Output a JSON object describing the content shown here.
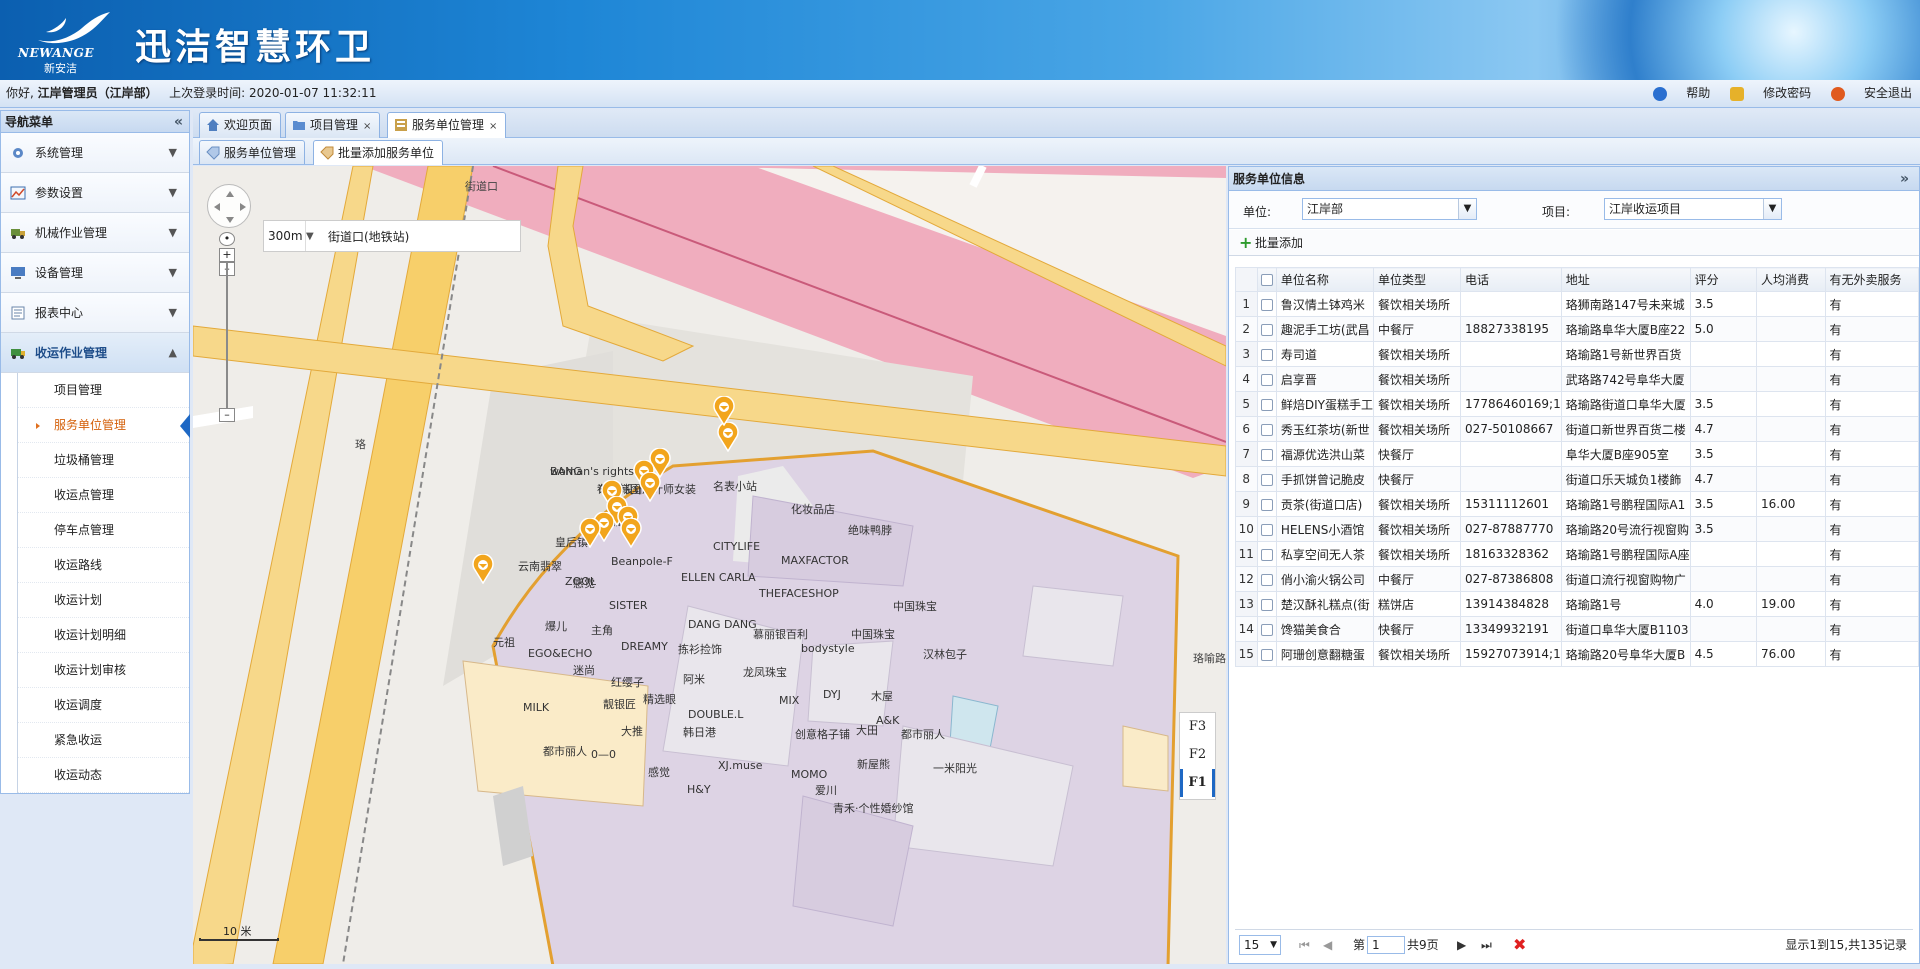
{
  "header": {
    "logo_en": "NEWANGE",
    "logo_cn": "新安洁",
    "title": "迅洁智慧环卫"
  },
  "userbar": {
    "greeting": "你好,",
    "user": "江岸管理员（江岸部）",
    "last_login_label": "上次登录时间:",
    "last_login": "2020-01-07 11:32:11",
    "help": "帮助",
    "change_pwd": "修改密码",
    "logout": "安全退出"
  },
  "nav": {
    "title": "导航菜单",
    "collapse": "«",
    "groups": [
      {
        "label": "系统管理",
        "icon": "gear-icon"
      },
      {
        "label": "参数设置",
        "icon": "chart-icon"
      },
      {
        "label": "机械作业管理",
        "icon": "truck-icon"
      },
      {
        "label": "设备管理",
        "icon": "monitor-icon"
      },
      {
        "label": "报表中心",
        "icon": "report-icon"
      },
      {
        "label": "收运作业管理",
        "icon": "vehicle-icon"
      }
    ],
    "subitems": [
      "项目管理",
      "服务单位管理",
      "垃圾桶管理",
      "收运点管理",
      "停车点管理",
      "收运路线",
      "收运计划",
      "收运计划明细",
      "收运计划审核",
      "收运调度",
      "紧急收运",
      "收运动态"
    ]
  },
  "tabs": {
    "main": [
      {
        "label": "欢迎页面"
      },
      {
        "label": "项目管理",
        "close": "×"
      },
      {
        "label": "服务单位管理",
        "close": "×"
      }
    ],
    "sub": [
      {
        "label": "服务单位管理"
      },
      {
        "label": "批量添加服务单位"
      }
    ]
  },
  "map": {
    "radius": "300m",
    "search": "街道口(地铁站)",
    "station": "街道口",
    "road": "珞喻路",
    "road_side": "珞",
    "floors": [
      "F3",
      "F2",
      "F1"
    ],
    "active_floor": "F1",
    "scale": "10 米",
    "shops": [
      "BANG",
      "布道·设计",
      "名表小站",
      "化妆品店",
      "绝味鸭脖",
      "尚品",
      "皇后镇",
      "CITYLIFE",
      "MAXFACTOR",
      "云南翡翠",
      "感觉",
      "Beanpole-F",
      "ZOOL",
      "ELLEN CARLA",
      "THEFACESHOP",
      "中国珠宝",
      "SISTER",
      "元祖",
      "爆儿",
      "主角",
      "DANG DANG",
      "慕丽银百利",
      "bodystyle",
      "中国珠宝",
      "汉林包子",
      "EGO&ECHO",
      "DREAMY",
      "拣衫捡饰",
      "迷尚",
      "红缨子",
      "阿米",
      "龙凤珠宝",
      "靓银匠",
      "精选眼",
      "MIX",
      "DYJ",
      "木屋",
      "MILK",
      "DOUBLE.L",
      "A&K",
      "大推",
      "韩日港",
      "大田",
      "都市丽人",
      "都市丽人",
      "0—0",
      "创意格子铺",
      "新屋熊",
      "感觉",
      "XJ.muse",
      "MOMO",
      "一米阳光",
      "H&Y",
      "爱川",
      "青禾·个性婚纱馆",
      "woman's rights",
      "记忆韩国设计师女装"
    ]
  },
  "panel": {
    "title": "服务单位信息",
    "collapse": "»",
    "unit_label": "单位:",
    "unit_value": "江岸部",
    "project_label": "项目:",
    "project_value": "江岸收运项目",
    "batch_add": "批量添加",
    "columns": [
      "单位名称",
      "单位类型",
      "电话",
      "地址",
      "评分",
      "人均消费",
      "有无外卖服务"
    ],
    "rows": [
      {
        "n": "1",
        "name": "鲁汉情土钵鸡米",
        "type": "餐饮相关场所",
        "phone": "",
        "addr": "珞狮南路147号未来城",
        "score": "3.5",
        "avg": "",
        "delivery": "有"
      },
      {
        "n": "2",
        "name": "趣泥手工坊(武昌",
        "type": "中餐厅",
        "phone": "18827338195",
        "addr": "珞瑜路阜华大厦B座22",
        "score": "5.0",
        "avg": "",
        "delivery": "有"
      },
      {
        "n": "3",
        "name": "寿司道",
        "type": "餐饮相关场所",
        "phone": "",
        "addr": "珞瑜路1号新世界百货",
        "score": "",
        "avg": "",
        "delivery": "有"
      },
      {
        "n": "4",
        "name": "启享晋",
        "type": "餐饮相关场所",
        "phone": "",
        "addr": "武珞路742号阜华大厦",
        "score": "",
        "avg": "",
        "delivery": "有"
      },
      {
        "n": "5",
        "name": "鲜焙DIY蛋糕手工",
        "type": "餐饮相关场所",
        "phone": "17786460169;1",
        "addr": "珞瑜路街道口阜华大厦",
        "score": "3.5",
        "avg": "",
        "delivery": "有"
      },
      {
        "n": "6",
        "name": "秀玉红茶坊(新世",
        "type": "餐饮相关场所",
        "phone": "027-50108667",
        "addr": "街道口新世界百货二楼",
        "score": "4.7",
        "avg": "",
        "delivery": "有"
      },
      {
        "n": "7",
        "name": "福源优选洪山菜",
        "type": "快餐厅",
        "phone": "",
        "addr": "阜华大厦B座905室",
        "score": "3.5",
        "avg": "",
        "delivery": "有"
      },
      {
        "n": "8",
        "name": "手抓饼曾记脆皮",
        "type": "快餐厅",
        "phone": "",
        "addr": "街道口乐天城负1楼飾",
        "score": "4.7",
        "avg": "",
        "delivery": "有"
      },
      {
        "n": "9",
        "name": "贡茶(街道口店)",
        "type": "餐饮相关场所",
        "phone": "15311112601",
        "addr": "珞瑜路1号鹏程国际A1",
        "score": "3.5",
        "avg": "16.00",
        "delivery": "有"
      },
      {
        "n": "10",
        "name": "HELENS小酒馆",
        "type": "餐饮相关场所",
        "phone": "027-87887770",
        "addr": "珞瑜路20号流行视窗购",
        "score": "3.5",
        "avg": "",
        "delivery": "有"
      },
      {
        "n": "11",
        "name": "私享空间无人茶",
        "type": "餐饮相关场所",
        "phone": "18163328362",
        "addr": "珞瑜路1号鹏程国际A座",
        "score": "",
        "avg": "",
        "delivery": "有"
      },
      {
        "n": "12",
        "name": "俏小渝火锅公司",
        "type": "中餐厅",
        "phone": "027-87386808",
        "addr": "街道口流行视窗购物广",
        "score": "",
        "avg": "",
        "delivery": "有"
      },
      {
        "n": "13",
        "name": "楚汉酥礼糕点(街",
        "type": "糕饼店",
        "phone": "13914384828",
        "addr": "珞瑜路1号",
        "score": "4.0",
        "avg": "19.00",
        "delivery": "有"
      },
      {
        "n": "14",
        "name": "馋猫美食合",
        "type": "快餐厅",
        "phone": "13349932191",
        "addr": "街道口阜华大厦B1103",
        "score": "",
        "avg": "",
        "delivery": "有"
      },
      {
        "n": "15",
        "name": "阿珊创意翻糖蛋",
        "type": "餐饮相关场所",
        "phone": "15927073914;1",
        "addr": "珞瑜路20号阜华大厦B",
        "score": "4.5",
        "avg": "76.00",
        "delivery": "有"
      }
    ],
    "pager": {
      "page_size": "15",
      "page_prefix": "第",
      "page": "1",
      "page_total": "共9页",
      "summary": "显示1到15,共135记录"
    }
  }
}
